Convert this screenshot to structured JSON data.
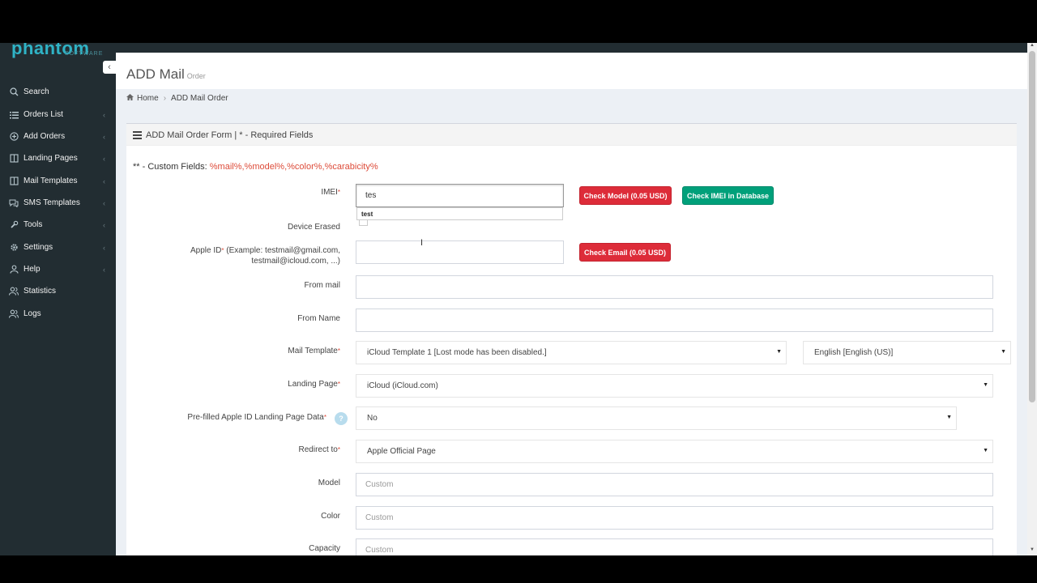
{
  "brand": {
    "logo": "phantom",
    "logo_sub": "SOFTWARE"
  },
  "sidebar": {
    "items": [
      {
        "label": "Search",
        "icon": "search-icon"
      },
      {
        "label": "Orders List",
        "icon": "list-icon"
      },
      {
        "label": "Add Orders",
        "icon": "plus-circle-icon"
      },
      {
        "label": "Landing Pages",
        "icon": "book-icon"
      },
      {
        "label": "Mail Templates",
        "icon": "book-icon"
      },
      {
        "label": "SMS Templates",
        "icon": "comments-icon"
      },
      {
        "label": "Tools",
        "icon": "wrench-icon"
      },
      {
        "label": "Settings",
        "icon": "gear-icon"
      },
      {
        "label": "Help",
        "icon": "user-icon"
      },
      {
        "label": "Statistics",
        "icon": "users-icon"
      },
      {
        "label": "Logs",
        "icon": "users-icon"
      }
    ]
  },
  "page": {
    "title": "ADD Mail",
    "subtitle": "Order",
    "breadcrumb": {
      "home": "Home",
      "current": "ADD Mail Order"
    }
  },
  "form": {
    "box_title": "ADD Mail Order Form | * - Required Fields",
    "custom_fields_label": "** - Custom Fields:",
    "custom_fields_value": "%mail%,%model%,%color%,%carabicity%",
    "required_mark": "*",
    "imei": {
      "label": "IMEI",
      "value": "tes",
      "suggestion": "test"
    },
    "device_erased": {
      "label": "Device Erased"
    },
    "apple_id": {
      "label": "Apple ID",
      "hint": "(Example: testmail@gmail.com, testmail@icloud.com, ...)",
      "value": ""
    },
    "from_mail": {
      "label": "From mail",
      "value": ""
    },
    "from_name": {
      "label": "From Name",
      "value": ""
    },
    "mail_template": {
      "label": "Mail Template",
      "value": "iCloud Template 1 [Lost mode has been disabled.]",
      "language": "English [English (US)]"
    },
    "landing_page": {
      "label": "Landing Page",
      "value": "iCloud (iCloud.com)"
    },
    "prefilled": {
      "label": "Pre-filled Apple ID Landing Page Data",
      "value": "No",
      "help": "?"
    },
    "redirect_to": {
      "label": "Redirect to",
      "value": "Apple Official Page"
    },
    "model": {
      "label": "Model",
      "placeholder": "Custom"
    },
    "color": {
      "label": "Color",
      "placeholder": "Custom"
    },
    "capacity": {
      "label": "Capacity",
      "placeholder": "Custom"
    },
    "buttons": {
      "check_model": "Check Model (0.05 USD)",
      "check_imei": "Check IMEI in Database",
      "check_email": "Check Email (0.05 USD)"
    }
  },
  "colors": {
    "sidebar": "#222d32",
    "danger": "#dd2c39",
    "success": "#00a07a"
  }
}
